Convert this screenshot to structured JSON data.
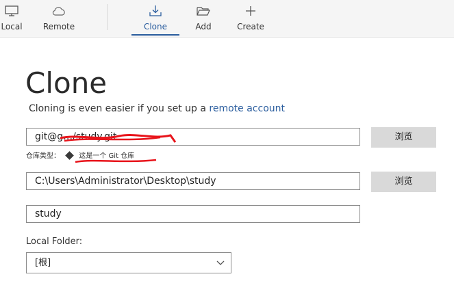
{
  "toolbar": {
    "local_label": "Local",
    "remote_label": "Remote",
    "clone_label": "Clone",
    "add_label": "Add",
    "create_label": "Create",
    "active_tab": "Clone",
    "accent_color": "#2a5d9e"
  },
  "clone": {
    "title": "Clone",
    "subtitle_prefix": "Cloning is even easier if you set up a",
    "subtitle_link": "remote account",
    "source_url": "git@g…/study.git",
    "repo_type_label": "仓库类型：",
    "repo_type_value": "这是一个 Git 仓库",
    "destination_path": "C:\\Users\\Administrator\\Desktop\\study",
    "name": "study",
    "browse_label_1": "浏览",
    "browse_label_2": "浏览",
    "local_folder_label": "Local Folder:",
    "local_folder_value": "[根]"
  },
  "icons": {
    "local": "monitor-icon",
    "remote": "cloud-icon",
    "clone": "download-icon",
    "add": "folder-open-icon",
    "create": "plus-icon",
    "dropdown": "chevron-down-icon",
    "repo_type": "git-diamond-icon"
  },
  "annotation_color": "#e8141b"
}
